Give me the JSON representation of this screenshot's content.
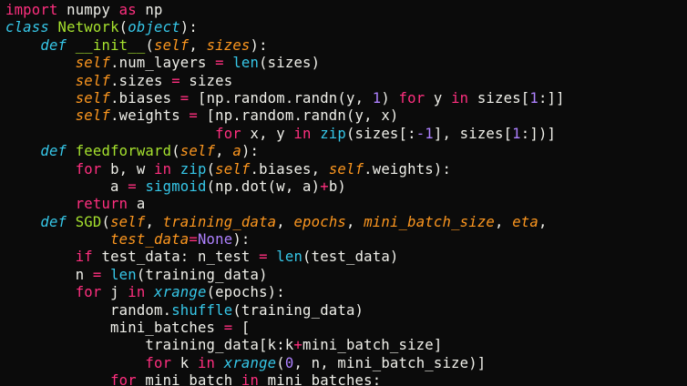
{
  "editor": {
    "colors": {
      "background": "#0b0b0b",
      "text": "#f0f0ea",
      "keyword": "#ff2f7f",
      "function_name": "#a6e22e",
      "builtin": "#36c7e8",
      "parameter": "#fd971f",
      "number": "#ae81ff"
    },
    "lines": [
      [
        {
          "t": "import",
          "k": "kw"
        },
        {
          "t": " numpy ",
          "k": "plain"
        },
        {
          "t": "as",
          "k": "kw"
        },
        {
          "t": " np",
          "k": "plain"
        }
      ],
      [
        {
          "t": "class",
          "k": "type"
        },
        {
          "t": " ",
          "k": "plain"
        },
        {
          "t": "Network",
          "k": "cls"
        },
        {
          "t": "(",
          "k": "plain"
        },
        {
          "t": "object",
          "k": "type"
        },
        {
          "t": "):",
          "k": "plain"
        }
      ],
      [
        {
          "t": "    ",
          "k": "plain"
        },
        {
          "t": "def",
          "k": "type"
        },
        {
          "t": " ",
          "k": "plain"
        },
        {
          "t": "__init__",
          "k": "fn"
        },
        {
          "t": "(",
          "k": "plain"
        },
        {
          "t": "self",
          "k": "param"
        },
        {
          "t": ", ",
          "k": "plain"
        },
        {
          "t": "sizes",
          "k": "param"
        },
        {
          "t": "):",
          "k": "plain"
        }
      ],
      [
        {
          "t": "        ",
          "k": "plain"
        },
        {
          "t": "self",
          "k": "self"
        },
        {
          "t": ".num_layers ",
          "k": "plain"
        },
        {
          "t": "=",
          "k": "op"
        },
        {
          "t": " ",
          "k": "plain"
        },
        {
          "t": "len",
          "k": "builtin"
        },
        {
          "t": "(sizes)",
          "k": "plain"
        }
      ],
      [
        {
          "t": "        ",
          "k": "plain"
        },
        {
          "t": "self",
          "k": "self"
        },
        {
          "t": ".sizes ",
          "k": "plain"
        },
        {
          "t": "=",
          "k": "op"
        },
        {
          "t": " sizes",
          "k": "plain"
        }
      ],
      [
        {
          "t": "        ",
          "k": "plain"
        },
        {
          "t": "self",
          "k": "self"
        },
        {
          "t": ".biases ",
          "k": "plain"
        },
        {
          "t": "=",
          "k": "op"
        },
        {
          "t": " [np.random.randn(y, ",
          "k": "plain"
        },
        {
          "t": "1",
          "k": "num"
        },
        {
          "t": ") ",
          "k": "plain"
        },
        {
          "t": "for",
          "k": "kw"
        },
        {
          "t": " y ",
          "k": "plain"
        },
        {
          "t": "in",
          "k": "kw"
        },
        {
          "t": " sizes[",
          "k": "plain"
        },
        {
          "t": "1",
          "k": "num"
        },
        {
          "t": ":]]",
          "k": "plain"
        }
      ],
      [
        {
          "t": "        ",
          "k": "plain"
        },
        {
          "t": "self",
          "k": "self"
        },
        {
          "t": ".weights ",
          "k": "plain"
        },
        {
          "t": "=",
          "k": "op"
        },
        {
          "t": " [np.random.randn(y, x)",
          "k": "plain"
        }
      ],
      [
        {
          "t": "                        ",
          "k": "plain"
        },
        {
          "t": "for",
          "k": "kw"
        },
        {
          "t": " x, y ",
          "k": "plain"
        },
        {
          "t": "in",
          "k": "kw"
        },
        {
          "t": " ",
          "k": "plain"
        },
        {
          "t": "zip",
          "k": "builtin"
        },
        {
          "t": "(sizes[:",
          "k": "plain"
        },
        {
          "t": "-1",
          "k": "num"
        },
        {
          "t": "], sizes[",
          "k": "plain"
        },
        {
          "t": "1",
          "k": "num"
        },
        {
          "t": ":])]",
          "k": "plain"
        }
      ],
      [
        {
          "t": "    ",
          "k": "plain"
        },
        {
          "t": "def",
          "k": "type"
        },
        {
          "t": " ",
          "k": "plain"
        },
        {
          "t": "feedforward",
          "k": "fn"
        },
        {
          "t": "(",
          "k": "plain"
        },
        {
          "t": "self",
          "k": "param"
        },
        {
          "t": ", ",
          "k": "plain"
        },
        {
          "t": "a",
          "k": "param"
        },
        {
          "t": "):",
          "k": "plain"
        }
      ],
      [
        {
          "t": "        ",
          "k": "plain"
        },
        {
          "t": "for",
          "k": "kw"
        },
        {
          "t": " b, w ",
          "k": "plain"
        },
        {
          "t": "in",
          "k": "kw"
        },
        {
          "t": " ",
          "k": "plain"
        },
        {
          "t": "zip",
          "k": "builtin"
        },
        {
          "t": "(",
          "k": "plain"
        },
        {
          "t": "self",
          "k": "self"
        },
        {
          "t": ".biases, ",
          "k": "plain"
        },
        {
          "t": "self",
          "k": "self"
        },
        {
          "t": ".weights):",
          "k": "plain"
        }
      ],
      [
        {
          "t": "            a ",
          "k": "plain"
        },
        {
          "t": "=",
          "k": "op"
        },
        {
          "t": " ",
          "k": "plain"
        },
        {
          "t": "sigmoid",
          "k": "builtin"
        },
        {
          "t": "(np.dot(w, a)",
          "k": "plain"
        },
        {
          "t": "+",
          "k": "op"
        },
        {
          "t": "b)",
          "k": "plain"
        }
      ],
      [
        {
          "t": "        ",
          "k": "plain"
        },
        {
          "t": "return",
          "k": "kw"
        },
        {
          "t": " a",
          "k": "plain"
        }
      ],
      [
        {
          "t": "    ",
          "k": "plain"
        },
        {
          "t": "def",
          "k": "type"
        },
        {
          "t": " ",
          "k": "plain"
        },
        {
          "t": "SGD",
          "k": "fn"
        },
        {
          "t": "(",
          "k": "plain"
        },
        {
          "t": "self",
          "k": "param"
        },
        {
          "t": ", ",
          "k": "plain"
        },
        {
          "t": "training_data",
          "k": "param"
        },
        {
          "t": ", ",
          "k": "plain"
        },
        {
          "t": "epochs",
          "k": "param"
        },
        {
          "t": ", ",
          "k": "plain"
        },
        {
          "t": "mini_batch_size",
          "k": "param"
        },
        {
          "t": ", ",
          "k": "plain"
        },
        {
          "t": "eta",
          "k": "param"
        },
        {
          "t": ",",
          "k": "plain"
        }
      ],
      [
        {
          "t": "            ",
          "k": "plain"
        },
        {
          "t": "test_data",
          "k": "param"
        },
        {
          "t": "=",
          "k": "op"
        },
        {
          "t": "None",
          "k": "const"
        },
        {
          "t": "):",
          "k": "plain"
        }
      ],
      [
        {
          "t": "        ",
          "k": "plain"
        },
        {
          "t": "if",
          "k": "kw"
        },
        {
          "t": " test_data: n_test ",
          "k": "plain"
        },
        {
          "t": "=",
          "k": "op"
        },
        {
          "t": " ",
          "k": "plain"
        },
        {
          "t": "len",
          "k": "builtin"
        },
        {
          "t": "(test_data)",
          "k": "plain"
        }
      ],
      [
        {
          "t": "        n ",
          "k": "plain"
        },
        {
          "t": "=",
          "k": "op"
        },
        {
          "t": " ",
          "k": "plain"
        },
        {
          "t": "len",
          "k": "builtin"
        },
        {
          "t": "(training_data)",
          "k": "plain"
        }
      ],
      [
        {
          "t": "        ",
          "k": "plain"
        },
        {
          "t": "for",
          "k": "kw"
        },
        {
          "t": " j ",
          "k": "plain"
        },
        {
          "t": "in",
          "k": "kw"
        },
        {
          "t": " ",
          "k": "plain"
        },
        {
          "t": "xrange",
          "k": "type"
        },
        {
          "t": "(epochs):",
          "k": "plain"
        }
      ],
      [
        {
          "t": "            random.",
          "k": "plain"
        },
        {
          "t": "shuffle",
          "k": "builtin"
        },
        {
          "t": "(training_data)",
          "k": "plain"
        }
      ],
      [
        {
          "t": "            mini_batches ",
          "k": "plain"
        },
        {
          "t": "=",
          "k": "op"
        },
        {
          "t": " [",
          "k": "plain"
        }
      ],
      [
        {
          "t": "                training_data[k:k",
          "k": "plain"
        },
        {
          "t": "+",
          "k": "op"
        },
        {
          "t": "mini_batch_size]",
          "k": "plain"
        }
      ],
      [
        {
          "t": "                ",
          "k": "plain"
        },
        {
          "t": "for",
          "k": "kw"
        },
        {
          "t": " k ",
          "k": "plain"
        },
        {
          "t": "in",
          "k": "kw"
        },
        {
          "t": " ",
          "k": "plain"
        },
        {
          "t": "xrange",
          "k": "type"
        },
        {
          "t": "(",
          "k": "plain"
        },
        {
          "t": "0",
          "k": "num"
        },
        {
          "t": ", n, mini_batch_size)]",
          "k": "plain"
        }
      ],
      [
        {
          "t": "            ",
          "k": "plain"
        },
        {
          "t": "for",
          "k": "kw"
        },
        {
          "t": " mini_batch ",
          "k": "plain"
        },
        {
          "t": "in",
          "k": "kw"
        },
        {
          "t": " mini_batches:",
          "k": "plain"
        }
      ]
    ]
  }
}
